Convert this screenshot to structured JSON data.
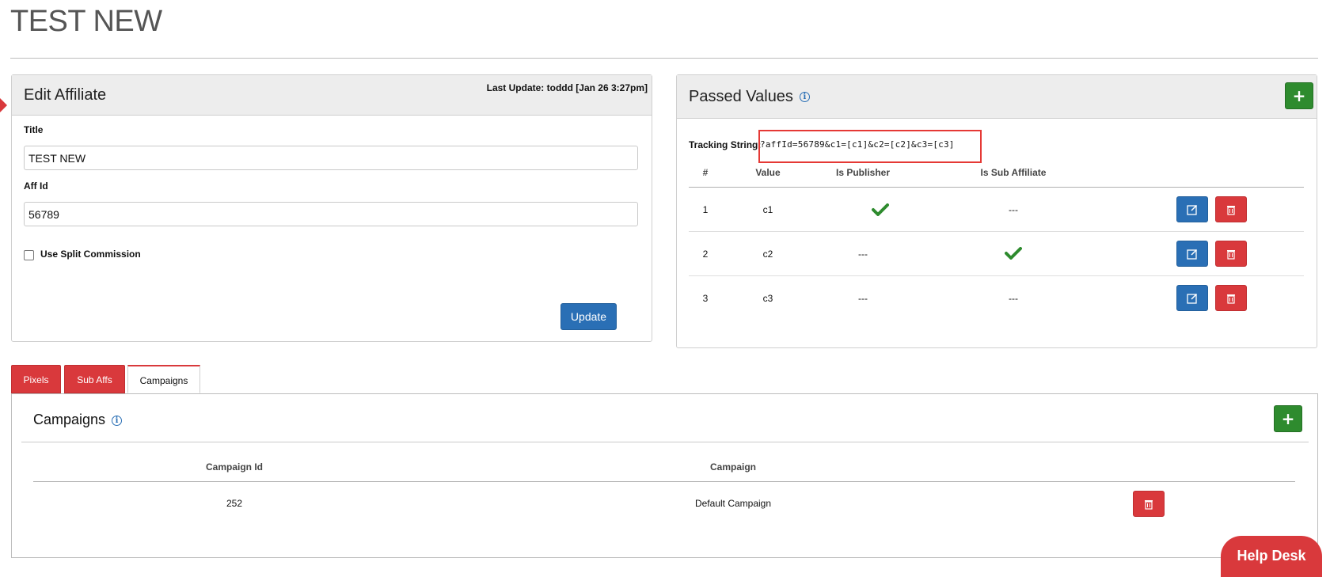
{
  "page": {
    "title": "TEST NEW"
  },
  "edit_affiliate": {
    "heading": "Edit Affiliate",
    "last_update": "Last Update: toddd [Jan 26 3:27pm]",
    "title_label": "Title",
    "title_value": "TEST NEW",
    "affid_label": "Aff Id",
    "affid_value": "56789",
    "split_label": "Use Split Commission",
    "split_checked": false,
    "update_label": "Update"
  },
  "passed_values": {
    "heading": "Passed Values",
    "add_label": "+",
    "tracking_label": "Tracking String:",
    "tracking_value": "?affId=56789&c1=[c1]&c2=[c2]&c3=[c3]",
    "columns": [
      "#",
      "Value",
      "Is Publisher",
      "Is Sub Affiliate"
    ],
    "rows": [
      {
        "num": "1",
        "value": "c1",
        "is_publisher": "check",
        "is_sub_affiliate": "---"
      },
      {
        "num": "2",
        "value": "c2",
        "is_publisher": "---",
        "is_sub_affiliate": "check"
      },
      {
        "num": "3",
        "value": "c3",
        "is_publisher": "---",
        "is_sub_affiliate": "---"
      }
    ]
  },
  "tabs": [
    {
      "label": "Pixels",
      "active": false
    },
    {
      "label": "Sub Affs",
      "active": false
    },
    {
      "label": "Campaigns",
      "active": true
    }
  ],
  "campaigns": {
    "heading": "Campaigns",
    "add_label": "+",
    "columns": [
      "Campaign Id",
      "Campaign"
    ],
    "rows": [
      {
        "id": "252",
        "name": "Default Campaign"
      }
    ]
  },
  "help_desk": {
    "label": "Help Desk"
  },
  "colors": {
    "brand_red": "#d9393c",
    "primary_blue": "#2a6fb5",
    "success_green": "#2e8b2e",
    "highlight_red": "#e53935"
  },
  "icons": {
    "info": "info-circle-icon",
    "add": "plus-icon",
    "edit": "edit-icon",
    "delete": "trash-icon",
    "check": "check-icon"
  }
}
